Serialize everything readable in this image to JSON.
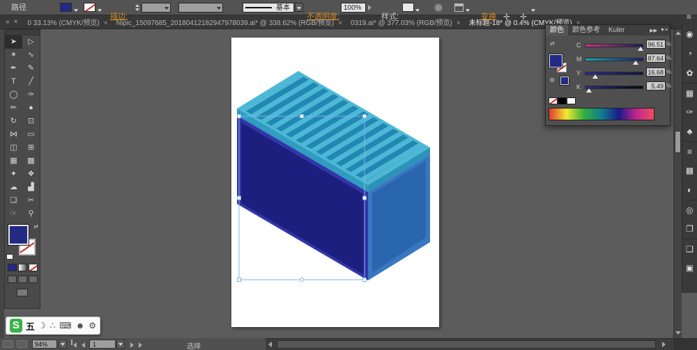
{
  "control_bar": {
    "selection_type": "路径",
    "stroke_label": "描边:",
    "stroke_style": "基本",
    "opacity_label": "不透明度:",
    "opacity_value": "100%",
    "style_label": "样式:",
    "transform_label": "变换",
    "fill_color": "#232a84"
  },
  "icons": {
    "collapse": "«",
    "close": "×",
    "menu": "≡",
    "expand": "▶▶",
    "panel_menu": "▼≡",
    "swap": "⇄",
    "fourway": "✛",
    "web": "⊕",
    "mini_swap": "⇄"
  },
  "tabs": {
    "items": [
      {
        "label": "0 33.13% (CMYK/预览)",
        "close": "×"
      },
      {
        "label": "Nipic_15097685_20180412182947978039.ai* @ 338.62% (RGB/预览)",
        "close": "×"
      },
      {
        "label": "0319.ai* @ 377.03% (RGB/预览)",
        "close": "×"
      },
      {
        "label": "未标题-18* @ 0.4% (CMYK/预览)",
        "close": "×",
        "active": true
      }
    ]
  },
  "toolbar": {
    "tools": [
      {
        "name": "selection-tool",
        "glyph": "➤",
        "active": true
      },
      {
        "name": "direct-selection-tool",
        "glyph": "▷"
      },
      {
        "name": "magic-wand-tool",
        "glyph": "✶"
      },
      {
        "name": "lasso-tool",
        "glyph": "∿"
      },
      {
        "name": "pen-tool",
        "glyph": "✒"
      },
      {
        "name": "anchor-point-tool",
        "glyph": "✎"
      },
      {
        "name": "type-tool",
        "glyph": "T"
      },
      {
        "name": "line-segment-tool",
        "glyph": "╱"
      },
      {
        "name": "ellipse-tool",
        "glyph": "◯"
      },
      {
        "name": "paintbrush-tool",
        "glyph": "✑"
      },
      {
        "name": "pencil-tool",
        "glyph": "✏"
      },
      {
        "name": "blob-brush-tool",
        "glyph": "●"
      },
      {
        "name": "rotate-tool",
        "glyph": "↻"
      },
      {
        "name": "scale-tool",
        "glyph": "⊡"
      },
      {
        "name": "width-tool",
        "glyph": "⋈"
      },
      {
        "name": "free-transform-tool",
        "glyph": "▭"
      },
      {
        "name": "shape-builder-tool",
        "glyph": "◫"
      },
      {
        "name": "perspective-grid-tool",
        "glyph": "⊞"
      },
      {
        "name": "mesh-tool",
        "glyph": "▦"
      },
      {
        "name": "gradient-tool",
        "glyph": "▩"
      },
      {
        "name": "eyedropper-tool",
        "glyph": "✦"
      },
      {
        "name": "blend-tool",
        "glyph": "❖"
      },
      {
        "name": "symbol-sprayer-tool",
        "glyph": "☁"
      },
      {
        "name": "column-graph-tool",
        "glyph": "▟"
      },
      {
        "name": "artboard-tool",
        "glyph": "❏"
      },
      {
        "name": "slice-tool",
        "glyph": "✂"
      },
      {
        "name": "hand-tool",
        "glyph": "☞"
      },
      {
        "name": "zoom-tool",
        "glyph": "⚲"
      }
    ]
  },
  "color_panel": {
    "title_tabs": [
      "颜色",
      "颜色参考",
      "Kuler"
    ],
    "sliders": [
      {
        "label": "C",
        "value": "96.51",
        "unit": "%",
        "grad_from": "#d63384",
        "grad_to": "#191e5e"
      },
      {
        "label": "M",
        "value": "87.64",
        "unit": "%",
        "grad_from": "#1ba8b8",
        "grad_to": "#1c2070"
      },
      {
        "label": "Y",
        "value": "16.68",
        "unit": "%",
        "grad_from": "#2b2f96",
        "grad_to": "#12183c"
      },
      {
        "label": "K",
        "value": "5.49",
        "unit": "%",
        "grad_from": "#272c88",
        "grad_to": "#060810"
      }
    ],
    "fill_color": "#232a84",
    "spectrum": [
      "#e23b2e",
      "#f2e930",
      "#2fae3e",
      "#0f7f8c",
      "#1a1a8c",
      "#c0268c",
      "#ef4e63"
    ]
  },
  "dock": {
    "items": [
      {
        "name": "color-panel-icon",
        "glyph": "◉"
      },
      {
        "name": "color-guide-panel-icon",
        "glyph": "◔"
      },
      {
        "name": "kuler-panel-icon",
        "glyph": "✿"
      },
      {
        "name": "swatches-panel-icon",
        "glyph": "▦",
        "sep": true
      },
      {
        "name": "brushes-panel-icon",
        "glyph": "✑"
      },
      {
        "name": "symbols-panel-icon",
        "glyph": "♣"
      },
      {
        "name": "stroke-panel-icon",
        "glyph": "≡",
        "sep": true
      },
      {
        "name": "gradient-panel-icon",
        "glyph": "▩"
      },
      {
        "name": "transparency-panel-icon",
        "glyph": "◐"
      },
      {
        "name": "appearance-panel-icon",
        "glyph": "◎",
        "sep": true
      },
      {
        "name": "graphic-styles-panel-icon",
        "glyph": "❒"
      },
      {
        "name": "layers-panel-icon",
        "glyph": "❏",
        "sep": true
      },
      {
        "name": "artboards-panel-icon",
        "glyph": "▣"
      }
    ]
  },
  "status_bar": {
    "zoom": "94%",
    "artboard": "1",
    "tool": "选择"
  },
  "ime": {
    "logo": "S",
    "mode": "五",
    "icons": [
      {
        "name": "moon-icon",
        "glyph": "☽"
      },
      {
        "name": "dots-icon",
        "glyph": "∴"
      },
      {
        "name": "keyboard-icon",
        "glyph": "⌨"
      },
      {
        "name": "person-icon",
        "glyph": "☻"
      },
      {
        "name": "wrench-icon",
        "glyph": "⚙"
      }
    ]
  },
  "artwork": {
    "top_color": "#4cb8d6",
    "stripe_color": "#2188b2",
    "front_band_color": "#2f9cc0",
    "right_band_color": "#2a93b8",
    "front_frame_color": "#3136a8",
    "front_color": "#1d1f7e",
    "right_frame_color": "#3a77c2",
    "right_color": "#2a66ad",
    "selection_color": "#7fb3e8",
    "handle_fill": "#ffffff"
  }
}
